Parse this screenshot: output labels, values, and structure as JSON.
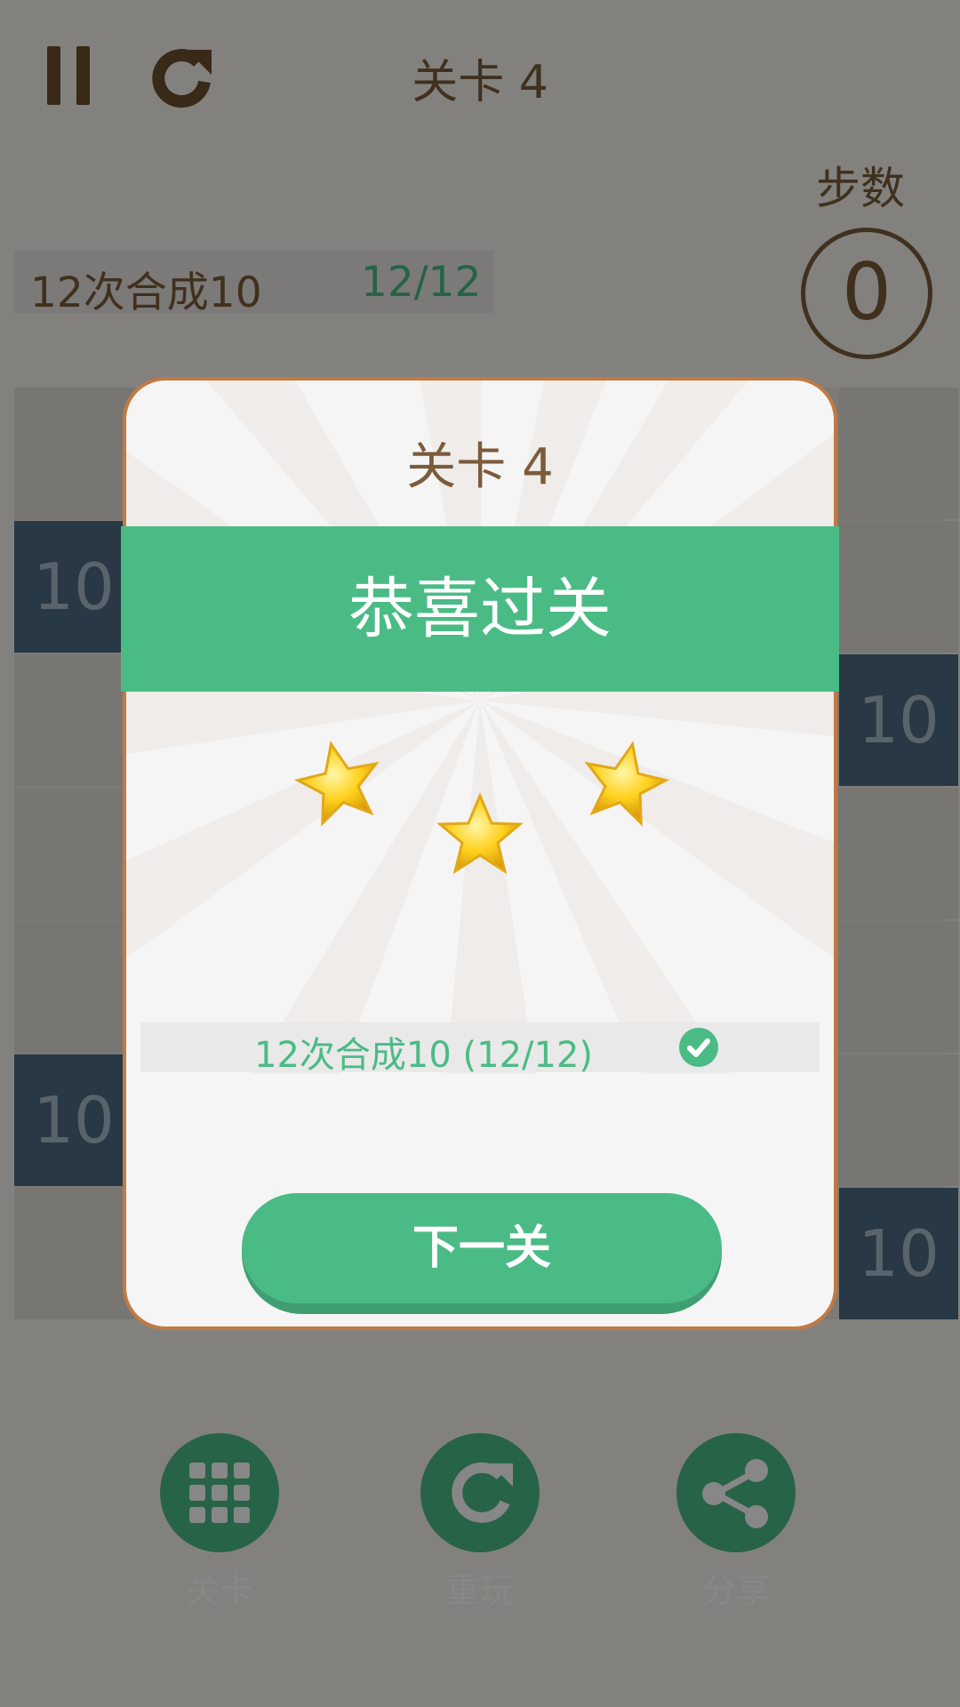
{
  "header": {
    "level_title": "关卡 4"
  },
  "steps": {
    "label": "步数",
    "value": "0"
  },
  "goal": {
    "text": "12次合成10",
    "progress": "12/12"
  },
  "board_tiles": {
    "value": "10"
  },
  "dialog": {
    "level_title": "关卡 4",
    "banner": "恭喜过关",
    "stars_earned": 3,
    "goal_row": "12次合成10 (12/12)",
    "next_button": "下一关"
  },
  "bottom_actions": [
    {
      "label": "关卡",
      "icon": "grid-icon"
    },
    {
      "label": "重玩",
      "icon": "replay-icon"
    },
    {
      "label": "分享",
      "icon": "share-icon"
    }
  ],
  "colors": {
    "accent_green": "#4bbb86",
    "brown_text": "#7a5b3a",
    "dialog_border": "#c27a43",
    "tile_blue": "#4d6b81",
    "star_gold": "#ffd21f"
  }
}
